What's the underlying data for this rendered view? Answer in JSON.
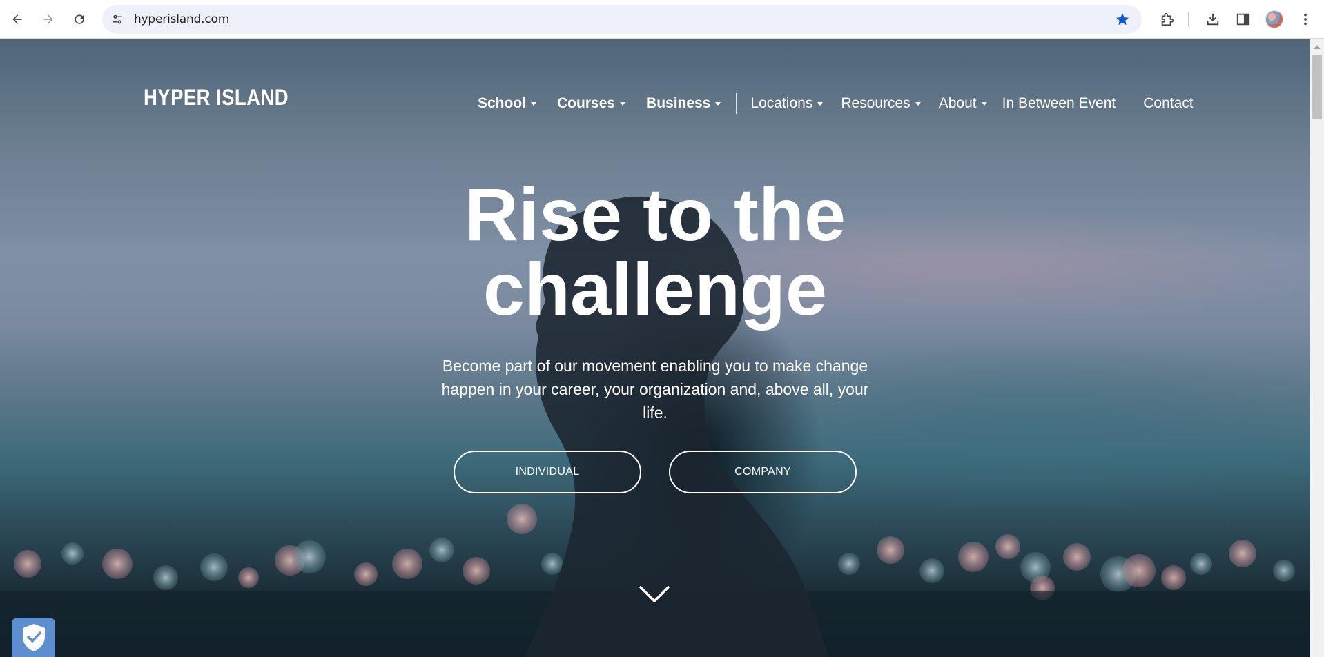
{
  "browser": {
    "url": "hyperisland.com",
    "icons": {
      "back": "back-arrow-icon",
      "forward": "forward-arrow-icon",
      "reload": "reload-icon",
      "site_info": "tune-icon",
      "bookmark": "star-icon",
      "extensions": "puzzle-icon",
      "downloads": "download-icon",
      "side_panel": "side-panel-icon",
      "menu": "kebab-menu-icon"
    },
    "bookmark_color": "#0b57d0"
  },
  "site": {
    "logo": "HYPER ISLAND",
    "nav_primary": [
      {
        "label": "School"
      },
      {
        "label": "Courses"
      },
      {
        "label": "Business"
      }
    ],
    "nav_secondary": [
      {
        "label": "Locations"
      },
      {
        "label": "Resources"
      },
      {
        "label": "About"
      },
      {
        "label": "In Between Event"
      },
      {
        "label": "Contact"
      }
    ]
  },
  "hero": {
    "title_line1": "Rise to the",
    "title_line2": "challenge",
    "subtitle": "Become part of our movement enabling you to make change happen in your career, your organization and, above all, your life.",
    "cta_individual": "INDIVIDUAL",
    "cta_company": "COMPANY"
  },
  "widgets": {
    "privacy_badge_color": "#5d8fd0"
  }
}
